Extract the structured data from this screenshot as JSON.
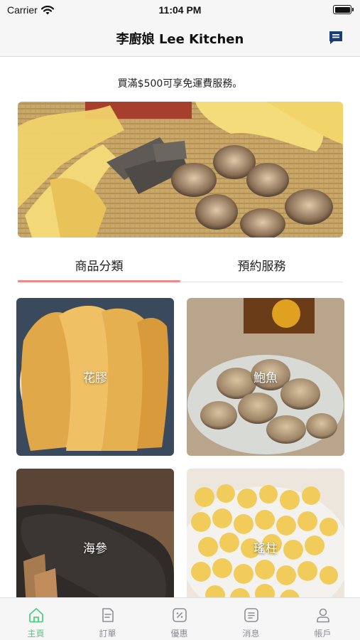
{
  "status_bar": {
    "carrier": "Carrier",
    "time": "11:04 PM"
  },
  "nav": {
    "title": "李廚娘 Lee Kitchen",
    "chat_icon": "chat-bubble-icon"
  },
  "notice": "買滿$500可享免運費服務。",
  "tabs": [
    {
      "label": "商品分類",
      "active": true
    },
    {
      "label": "預約服務",
      "active": false
    }
  ],
  "categories": [
    {
      "label": "花膠"
    },
    {
      "label": "鮑魚"
    },
    {
      "label": "海參"
    },
    {
      "label": "瑤柱"
    }
  ],
  "tabbar": [
    {
      "label": "主頁",
      "icon": "home-icon",
      "active": true
    },
    {
      "label": "訂單",
      "icon": "orders-icon",
      "active": false
    },
    {
      "label": "優惠",
      "icon": "coupon-icon",
      "active": false
    },
    {
      "label": "消息",
      "icon": "message-icon",
      "active": false
    },
    {
      "label": "帳戶",
      "icon": "account-icon",
      "active": false
    }
  ],
  "colors": {
    "accent": "#4cd07f",
    "tab_indicator": "#f08a8a",
    "nav_icon": "#1a3e7a",
    "inactive": "#8e8e93"
  }
}
